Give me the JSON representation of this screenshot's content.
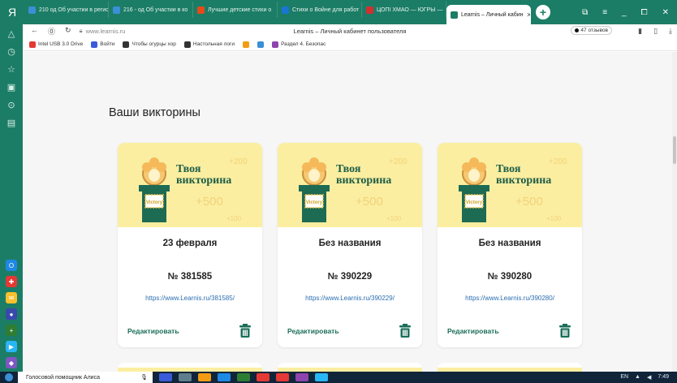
{
  "browser": {
    "tabs": [
      {
        "label": "210 од Об участии в регио",
        "color": "#3a8fd6",
        "active": false
      },
      {
        "label": "216 - од Об участии в ко",
        "color": "#3a8fd6",
        "active": false
      },
      {
        "label": "Лучшие детские стихи о",
        "color": "#e64a19",
        "active": false
      },
      {
        "label": "Стихи о Войне для работ",
        "color": "#1976d2",
        "active": false
      },
      {
        "label": "ЦОПI ХМАО — ЮГРЫ —",
        "color": "#d32f2f",
        "active": false
      },
      {
        "label": "Learnis – Личный кабин",
        "color": "#1c7d66",
        "active": true
      }
    ],
    "url_domain": "www.learnis.ru",
    "page_title": "Learnis – Личный кабинет пользователя",
    "reviews_label": "47 отзывов",
    "bookmarks": [
      {
        "label": "Intel USB 3.0 Drive",
        "color": "#e53935"
      },
      {
        "label": "Войти",
        "color": "#3a5bd9"
      },
      {
        "label": "Чтобы огурцы хор",
        "color": "#333333"
      },
      {
        "label": "Настольная логи",
        "color": "#333333"
      },
      {
        "label": "",
        "color": "#f39c12"
      },
      {
        "label": "",
        "color": "#3a8fd6"
      },
      {
        "label": "Раздел 4. Безопас",
        "color": "#8e44ad"
      }
    ]
  },
  "page": {
    "heading": "Ваши викторины",
    "banner_title_line1": "Твоя",
    "banner_title_line2": "викторина",
    "banner_pts_top": "+200",
    "banner_pts_mid": "+500",
    "banner_pts_bottom": "+100",
    "banner_sign": "Victory",
    "quizzes": [
      {
        "title": "23 февраля",
        "number": "№ 381585",
        "link": "https://www.Learnis.ru/381585/",
        "edit_label": "Редактировать"
      },
      {
        "title": "Без названия",
        "number": "№ 390229",
        "link": "https://www.Learnis.ru/390229/",
        "edit_label": "Редактировать"
      },
      {
        "title": "Без названия",
        "number": "№ 390280",
        "link": "https://www.Learnis.ru/390280/",
        "edit_label": "Редактировать"
      }
    ]
  },
  "taskbar": {
    "search_label": "Голосовой помощник Алиса",
    "lang": "EN",
    "time": "7:49"
  },
  "colors": {
    "accent": "#1c7d66",
    "banner_bg": "#fbeea0",
    "link": "#2b6fb0",
    "edit": "#1a6e58"
  }
}
